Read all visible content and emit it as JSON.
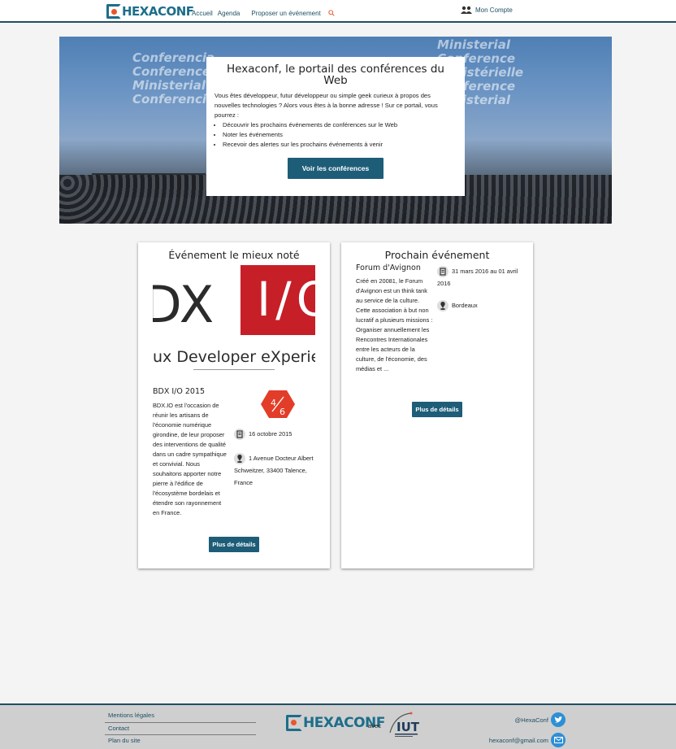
{
  "header": {
    "logo_text": "HEXACONF",
    "nav": [
      "Accueil",
      "Agenda",
      "Proposer un événement"
    ],
    "account_label": "Mon Compte"
  },
  "hero": {
    "title": "Hexaconf, le portail des conférences du Web",
    "intro": "Vous êtes développeur, futur développeur ou simple geek curieux à propos des nouvelles technologies ? Alors vous êtes à la bonne adresse ! Sur ce portail, vous pourrez :",
    "features": [
      "Découvrir les prochains événements de conférences sur le Web",
      "Noter les événements",
      "Recevoir des alertes sur les prochains événements à venir"
    ],
    "button_label": "Voir les conférences",
    "banner_lines": [
      "Conferencia",
      "Conference",
      "Ministerial",
      "Conferencia"
    ],
    "banner_lines_right": [
      "Ministerial",
      "Conference",
      "ministérielle",
      "Conference",
      "Ministerial"
    ]
  },
  "best_rated": {
    "section_title": "Événement le mieux noté",
    "logo": {
      "letters": "DX",
      "io": "I/O",
      "tagline": "ux Developer eXperience"
    },
    "name": "BDX I/O 2015",
    "description": "BDX.IO est l'occasion de réunir les artisans de l'économie numérique girondine, de leur proposer des interventions de qualité dans un cadre sympathique et convivial. Nous souhaitons apporter notre pierre à l'édifice de l'écosystème bordelais et étendre son rayonnement en France.",
    "rating": {
      "score": "4",
      "max": "6",
      "value": 4,
      "out_of": 6
    },
    "date": "16 octobre 2015",
    "location": "1 Avenue Docteur Albert Schweitzer, 33400 Talence, France",
    "button_label": "Plus de détails"
  },
  "next_event": {
    "section_title": "Prochain événement",
    "name": "Forum d'Avignon",
    "description": "Créé en 20081, le Forum d'Avignon est un think tank au service de la culture. Cette association à but non lucratif a plusieurs missions : Organiser annuellement les Rencontres Internationales entre les acteurs de la culture, de l'économie, des médias et ...",
    "date": "31 mars 2016 au 01 avril 2016",
    "location": "Bordeaux",
    "button_label": "Plus de détails"
  },
  "footer": {
    "links": [
      "Mentions légales",
      "Contact",
      "Plan du site"
    ],
    "logo_text": "HEXACONF",
    "with_label": "avec",
    "partner": "IUT",
    "twitter": "@HexaConf",
    "email": "hexaconf@gmail.com"
  },
  "colors": {
    "brand": "#1d6e8a",
    "accent": "#e8572b",
    "button": "#1d5d78",
    "bdx_red": "#c61f28",
    "rating_red": "#e23d28"
  },
  "icons": [
    "search-icon",
    "account-icon",
    "calendar-icon",
    "location-pin-icon",
    "twitter-icon",
    "mail-icon"
  ]
}
